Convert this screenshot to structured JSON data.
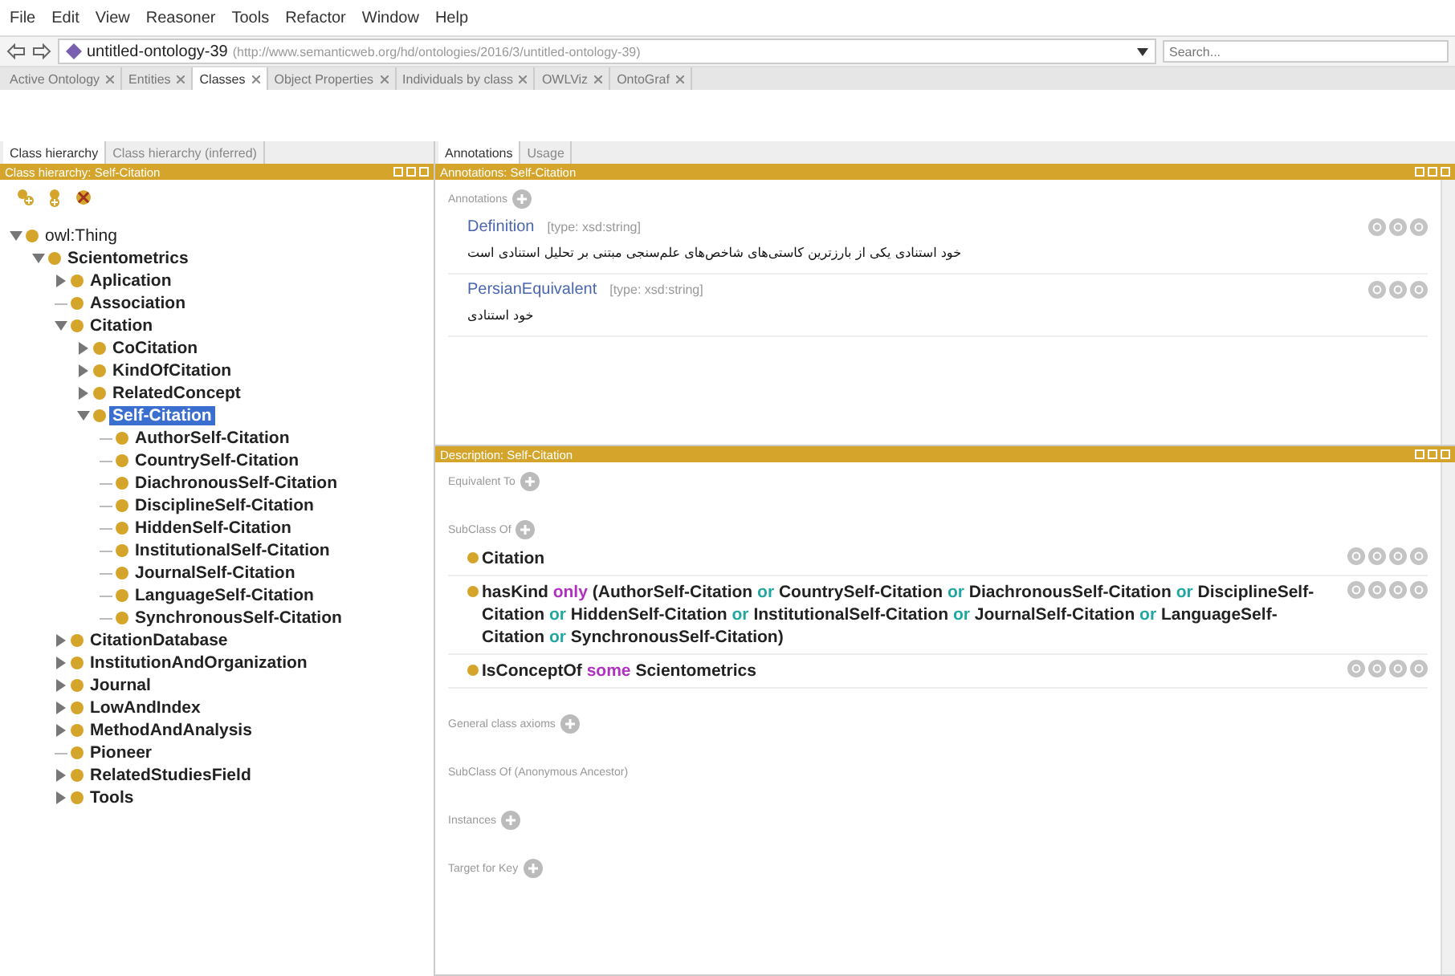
{
  "menu": [
    "File",
    "Edit",
    "View",
    "Reasoner",
    "Tools",
    "Refactor",
    "Window",
    "Help"
  ],
  "nav": {
    "ontology": "untitled-ontology-39",
    "iri": "(http://www.semanticweb.org/hd/ontologies/2016/3/untitled-ontology-39)",
    "search_placeholder": "Search..."
  },
  "tabs": [
    {
      "label": "Active Ontology",
      "selected": false
    },
    {
      "label": "Entities",
      "selected": false
    },
    {
      "label": "Classes",
      "selected": true
    },
    {
      "label": "Object Properties",
      "selected": false
    },
    {
      "label": "Individuals by class",
      "selected": false
    },
    {
      "label": "OWLViz",
      "selected": false
    },
    {
      "label": "OntoGraf",
      "selected": false
    }
  ],
  "left": {
    "subtabs": [
      {
        "label": "Class hierarchy",
        "selected": true
      },
      {
        "label": "Class hierarchy (inferred)",
        "selected": false
      }
    ],
    "header": "Class hierarchy: Self-Citation",
    "tree": [
      {
        "label": "owl:Thing",
        "kind": "branch",
        "expanded": true,
        "selected": false,
        "children": [
          {
            "label": "Scientometrics",
            "kind": "branch",
            "expanded": true,
            "selected": false,
            "children": [
              {
                "label": "Aplication",
                "kind": "branch",
                "expanded": false,
                "selected": false
              },
              {
                "label": "Association",
                "kind": "leaf",
                "selected": false
              },
              {
                "label": "Citation",
                "kind": "branch",
                "expanded": true,
                "selected": false,
                "children": [
                  {
                    "label": "CoCitation",
                    "kind": "branch",
                    "expanded": false,
                    "selected": false
                  },
                  {
                    "label": "KindOfCitation",
                    "kind": "branch",
                    "expanded": false,
                    "selected": false
                  },
                  {
                    "label": "RelatedConcept",
                    "kind": "branch",
                    "expanded": false,
                    "selected": false
                  },
                  {
                    "label": "Self-Citation",
                    "kind": "branch",
                    "expanded": true,
                    "selected": true,
                    "children": [
                      {
                        "label": "AuthorSelf-Citation",
                        "kind": "leaf",
                        "selected": false
                      },
                      {
                        "label": "CountrySelf-Citation",
                        "kind": "leaf",
                        "selected": false
                      },
                      {
                        "label": "DiachronousSelf-Citation",
                        "kind": "leaf",
                        "selected": false
                      },
                      {
                        "label": "DisciplineSelf-Citation",
                        "kind": "leaf",
                        "selected": false
                      },
                      {
                        "label": "HiddenSelf-Citation",
                        "kind": "leaf",
                        "selected": false
                      },
                      {
                        "label": "InstitutionalSelf-Citation",
                        "kind": "leaf",
                        "selected": false
                      },
                      {
                        "label": "JournalSelf-Citation",
                        "kind": "leaf",
                        "selected": false
                      },
                      {
                        "label": "LanguageSelf-Citation",
                        "kind": "leaf",
                        "selected": false
                      },
                      {
                        "label": "SynchronousSelf-Citation",
                        "kind": "leaf",
                        "selected": false
                      }
                    ]
                  }
                ]
              },
              {
                "label": "CitationDatabase",
                "kind": "branch",
                "expanded": false,
                "selected": false
              },
              {
                "label": "InstitutionAndOrganization",
                "kind": "branch",
                "expanded": false,
                "selected": false
              },
              {
                "label": "Journal",
                "kind": "branch",
                "expanded": false,
                "selected": false
              },
              {
                "label": "LowAndIndex",
                "kind": "branch",
                "expanded": false,
                "selected": false
              },
              {
                "label": "MethodAndAnalysis",
                "kind": "branch",
                "expanded": false,
                "selected": false
              },
              {
                "label": "Pioneer",
                "kind": "leaf",
                "selected": false
              },
              {
                "label": "RelatedStudiesField",
                "kind": "branch",
                "expanded": false,
                "selected": false
              },
              {
                "label": "Tools",
                "kind": "branch",
                "expanded": false,
                "selected": false
              }
            ]
          }
        ]
      }
    ]
  },
  "annotations": {
    "subtabs": [
      {
        "label": "Annotations",
        "selected": true
      },
      {
        "label": "Usage",
        "selected": false
      }
    ],
    "header": "Annotations: Self-Citation",
    "section": "Annotations",
    "items": [
      {
        "property": "Definition",
        "type": "[type: xsd:string]",
        "value": "خود استنادی یکی از بارزترین کاستی‌های شاخص‌های علم‌سنجی مبتنی بر تحلیل استنادی است"
      },
      {
        "property": "PersianEquivalent",
        "type": "[type: xsd:string]",
        "value": "خود استنادی"
      }
    ]
  },
  "description": {
    "header": "Description: Self-Citation",
    "sections": [
      {
        "label": "Equivalent To",
        "addable": true
      },
      {
        "label": "SubClass Of",
        "addable": true,
        "items": [
          {
            "parts": [
              {
                "text": "Citation",
                "kind": "class"
              }
            ]
          },
          {
            "parts": [
              {
                "text": "hasKind",
                "kind": "class"
              },
              {
                "text": "only",
                "kind": "keyword"
              },
              {
                "text": "(AuthorSelf-Citation",
                "kind": "class"
              },
              {
                "text": "or",
                "kind": "connective"
              },
              {
                "text": "CountrySelf-Citation",
                "kind": "class"
              },
              {
                "text": "or",
                "kind": "connective"
              },
              {
                "text": "DiachronousSelf-Citation",
                "kind": "class"
              },
              {
                "text": "or",
                "kind": "connective"
              },
              {
                "text": "DisciplineSelf-Citation",
                "kind": "class"
              },
              {
                "text": "or",
                "kind": "connective"
              },
              {
                "text": "HiddenSelf-Citation",
                "kind": "class"
              },
              {
                "text": "or",
                "kind": "connective"
              },
              {
                "text": "InstitutionalSelf-Citation",
                "kind": "class"
              },
              {
                "text": "or",
                "kind": "connective"
              },
              {
                "text": "JournalSelf-Citation",
                "kind": "class"
              },
              {
                "text": "or",
                "kind": "connective"
              },
              {
                "text": "LanguageSelf-Citation",
                "kind": "class"
              },
              {
                "text": "or",
                "kind": "connective"
              },
              {
                "text": "SynchronousSelf-Citation)",
                "kind": "class"
              }
            ]
          },
          {
            "parts": [
              {
                "text": "IsConceptOf",
                "kind": "class"
              },
              {
                "text": "some",
                "kind": "keyword"
              },
              {
                "text": "Scientometrics",
                "kind": "class"
              }
            ]
          }
        ]
      },
      {
        "label": "General class axioms",
        "addable": true
      },
      {
        "label": "SubClass Of (Anonymous Ancestor)",
        "addable": false
      },
      {
        "label": "Instances",
        "addable": true
      },
      {
        "label": "Target for Key",
        "addable": true
      }
    ]
  }
}
